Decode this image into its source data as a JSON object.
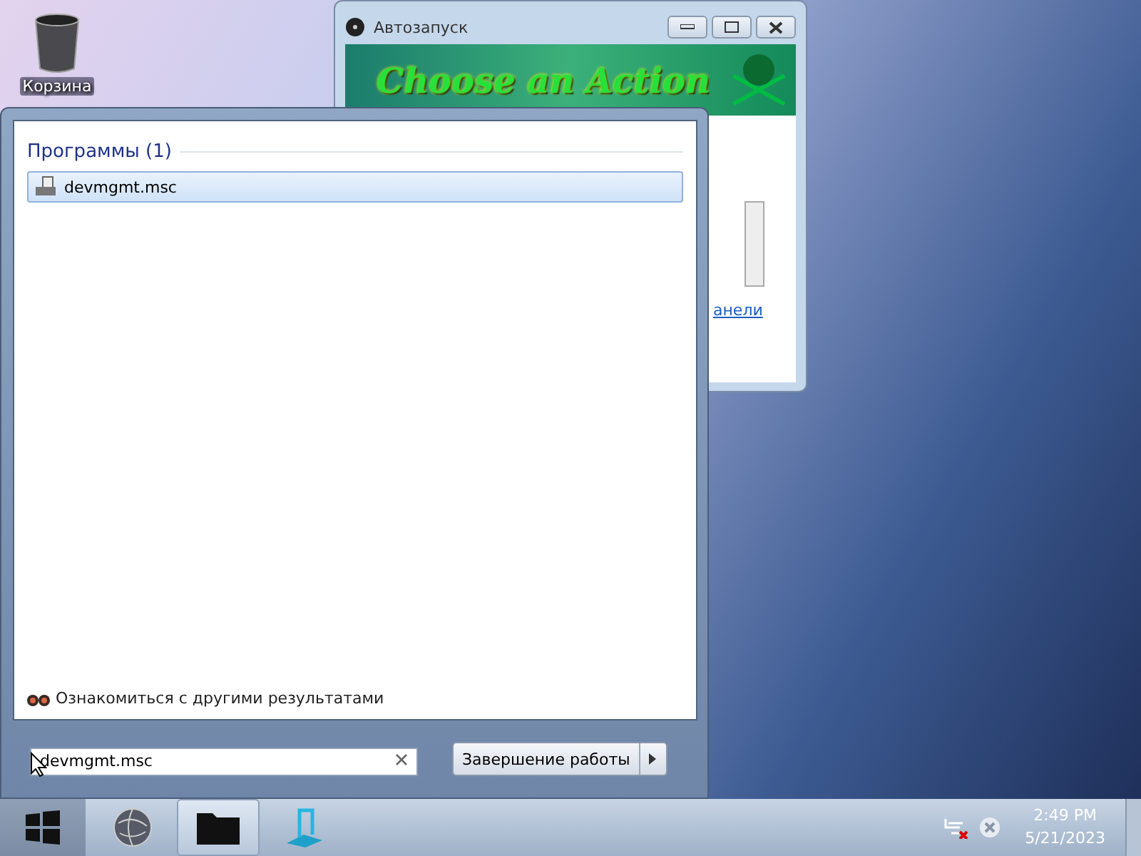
{
  "desktop_icons": [
    {
      "label": "Корзина"
    }
  ],
  "autorun_window": {
    "title": "Автозапуск",
    "banner": "Choose an Action",
    "link": "анели"
  },
  "start_menu": {
    "section": "Программы (1)",
    "results": [
      {
        "label": "devmgmt.msc",
        "selected": true
      }
    ],
    "more_results": "Ознакомиться с другими результатами",
    "search": {
      "value": "devmgmt.msc"
    },
    "shutdown": "Завершение работы"
  },
  "taskbar": {
    "items": [
      {
        "kind": "ie",
        "selected": false
      },
      {
        "kind": "folder",
        "selected": true
      },
      {
        "kind": "media",
        "selected": false
      }
    ],
    "time": "2:49 PM",
    "date": "5/21/2023"
  }
}
